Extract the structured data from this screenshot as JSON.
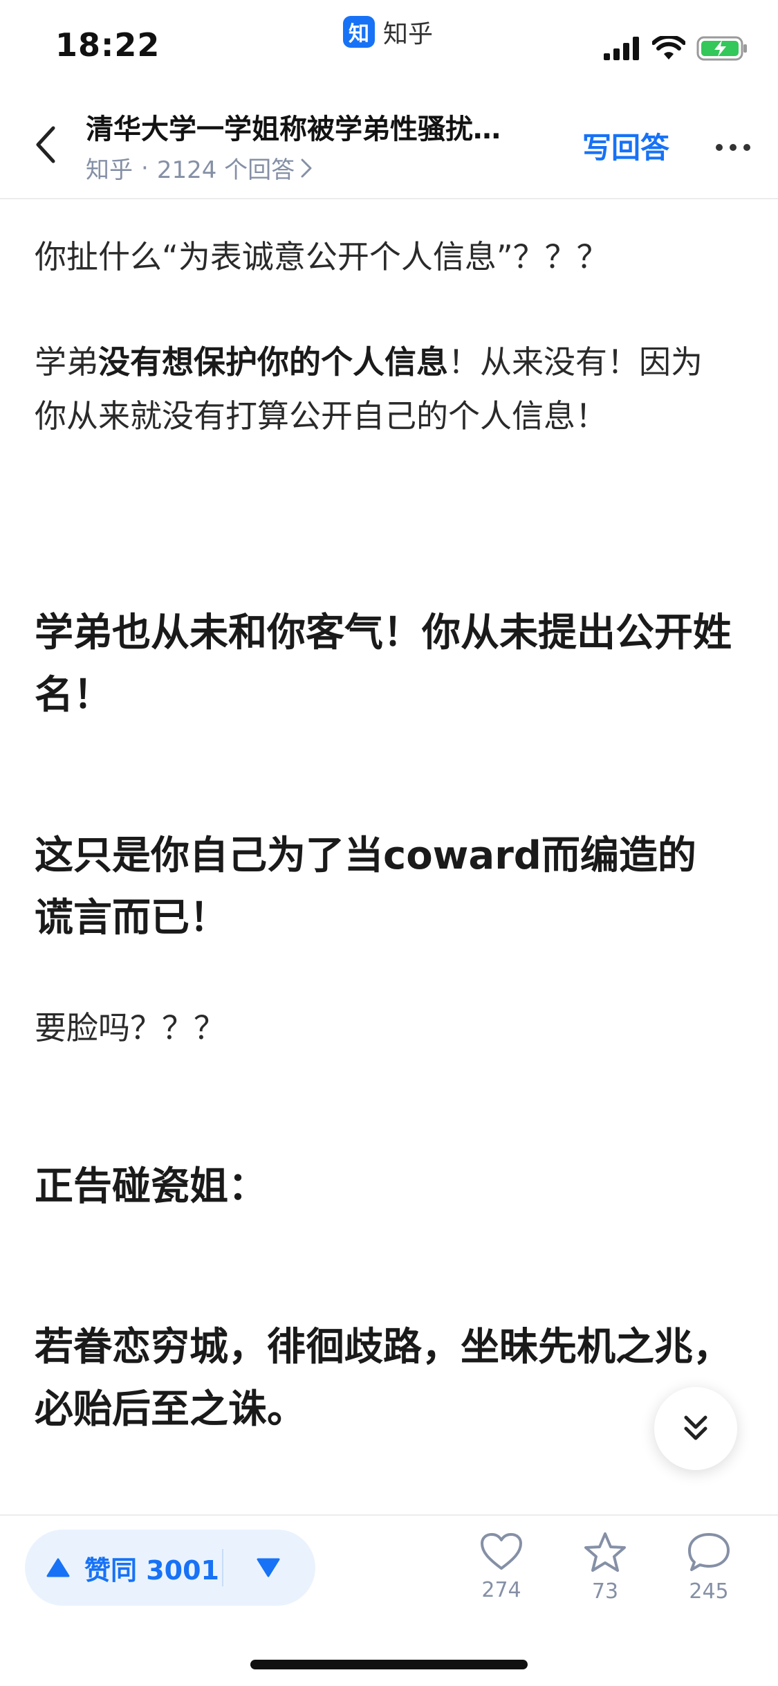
{
  "status_bar": {
    "time": "18:22",
    "app_badge": "知",
    "app_name": "知乎"
  },
  "header": {
    "title": "清华大学一学姐称被学弟性骚扰…",
    "source": "知乎",
    "separator": "·",
    "answer_count": "2124 个回答",
    "write_answer": "写回答"
  },
  "content": {
    "p1": "你扯什么“为表诚意公开个人信息”？？？",
    "p2_a": "学弟",
    "p2_b": "没有想保护你的个人信息",
    "p2_c": "！从来没有！因为你从来就没有打算公开自己的个人信息！",
    "p3": "学弟也从未和你客气！你从未提出公开姓名！",
    "p4": "这只是你自己为了当coward而编造的谎言而已！",
    "p5": "要脸吗？？？",
    "p6": "正告碰瓷姐：",
    "p7": "若眷恋穷城，徘徊歧路，坐昧先机之兆，必贻后至之诛。"
  },
  "bottom_bar": {
    "upvote_label": "赞同 3001",
    "like_count": "274",
    "favorite_count": "73",
    "comment_count": "245"
  },
  "colors": {
    "accent": "#1772f6",
    "muted": "#8590a6"
  },
  "icons": [
    "back-arrow-icon",
    "signal-icon",
    "wifi-icon",
    "battery-charging-icon",
    "chevron-right-icon",
    "more-icon",
    "double-chevron-down-icon",
    "triangle-up-icon",
    "triangle-down-icon",
    "heart-icon",
    "star-icon",
    "comment-icon"
  ]
}
